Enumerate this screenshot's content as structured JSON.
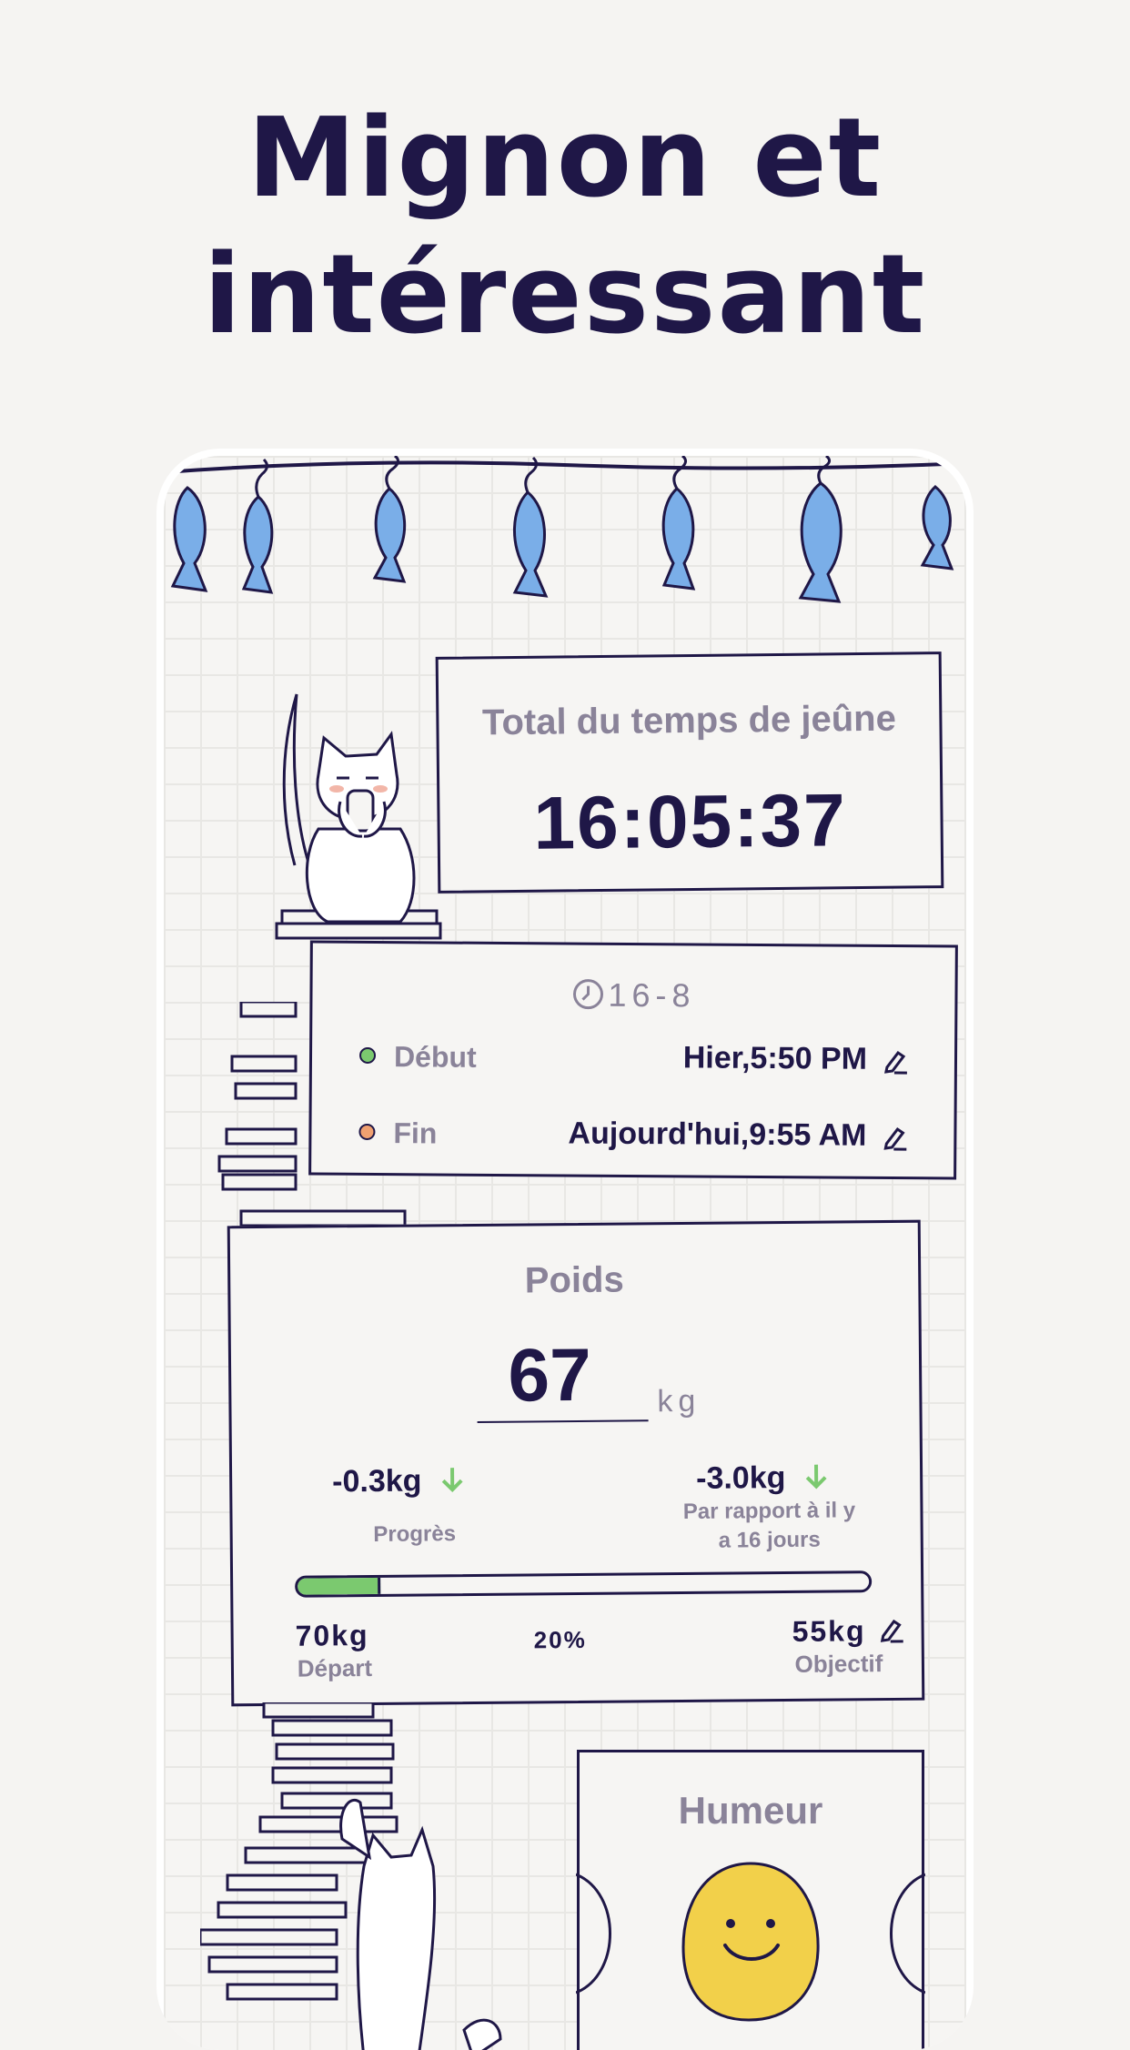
{
  "headline": {
    "line1": "Mignon et",
    "line2": "intéressant"
  },
  "timer": {
    "title": "Total du temps de jeûne",
    "value": "16:05:37"
  },
  "plan": {
    "name": "16-8",
    "start": {
      "label": "Début",
      "value": "Hier,5:50 PM",
      "dot_color": "#7bc96f"
    },
    "end": {
      "label": "Fin",
      "value": "Aujourd'hui,9:55 AM",
      "dot_color": "#f0a070"
    }
  },
  "weight": {
    "title": "Poids",
    "value": "67",
    "unit": "kg",
    "progress_change": "-0.3kg",
    "progress_label": "Progrès",
    "compare_change": "-3.0kg",
    "compare_label_1": "Par rapport à il y",
    "compare_label_2": "a 16 jours",
    "start_value": "70kg",
    "start_label": "Départ",
    "goal_value": "55kg",
    "goal_label": "Objectif",
    "percent_text": "20%",
    "progress_fraction": 0.14
  },
  "mood": {
    "title": "Humeur"
  },
  "colors": {
    "ink": "#1f1747",
    "muted": "#8a8399",
    "fish": "#7aaee8",
    "green": "#7bc96f",
    "smiley": "#f2d04a"
  }
}
